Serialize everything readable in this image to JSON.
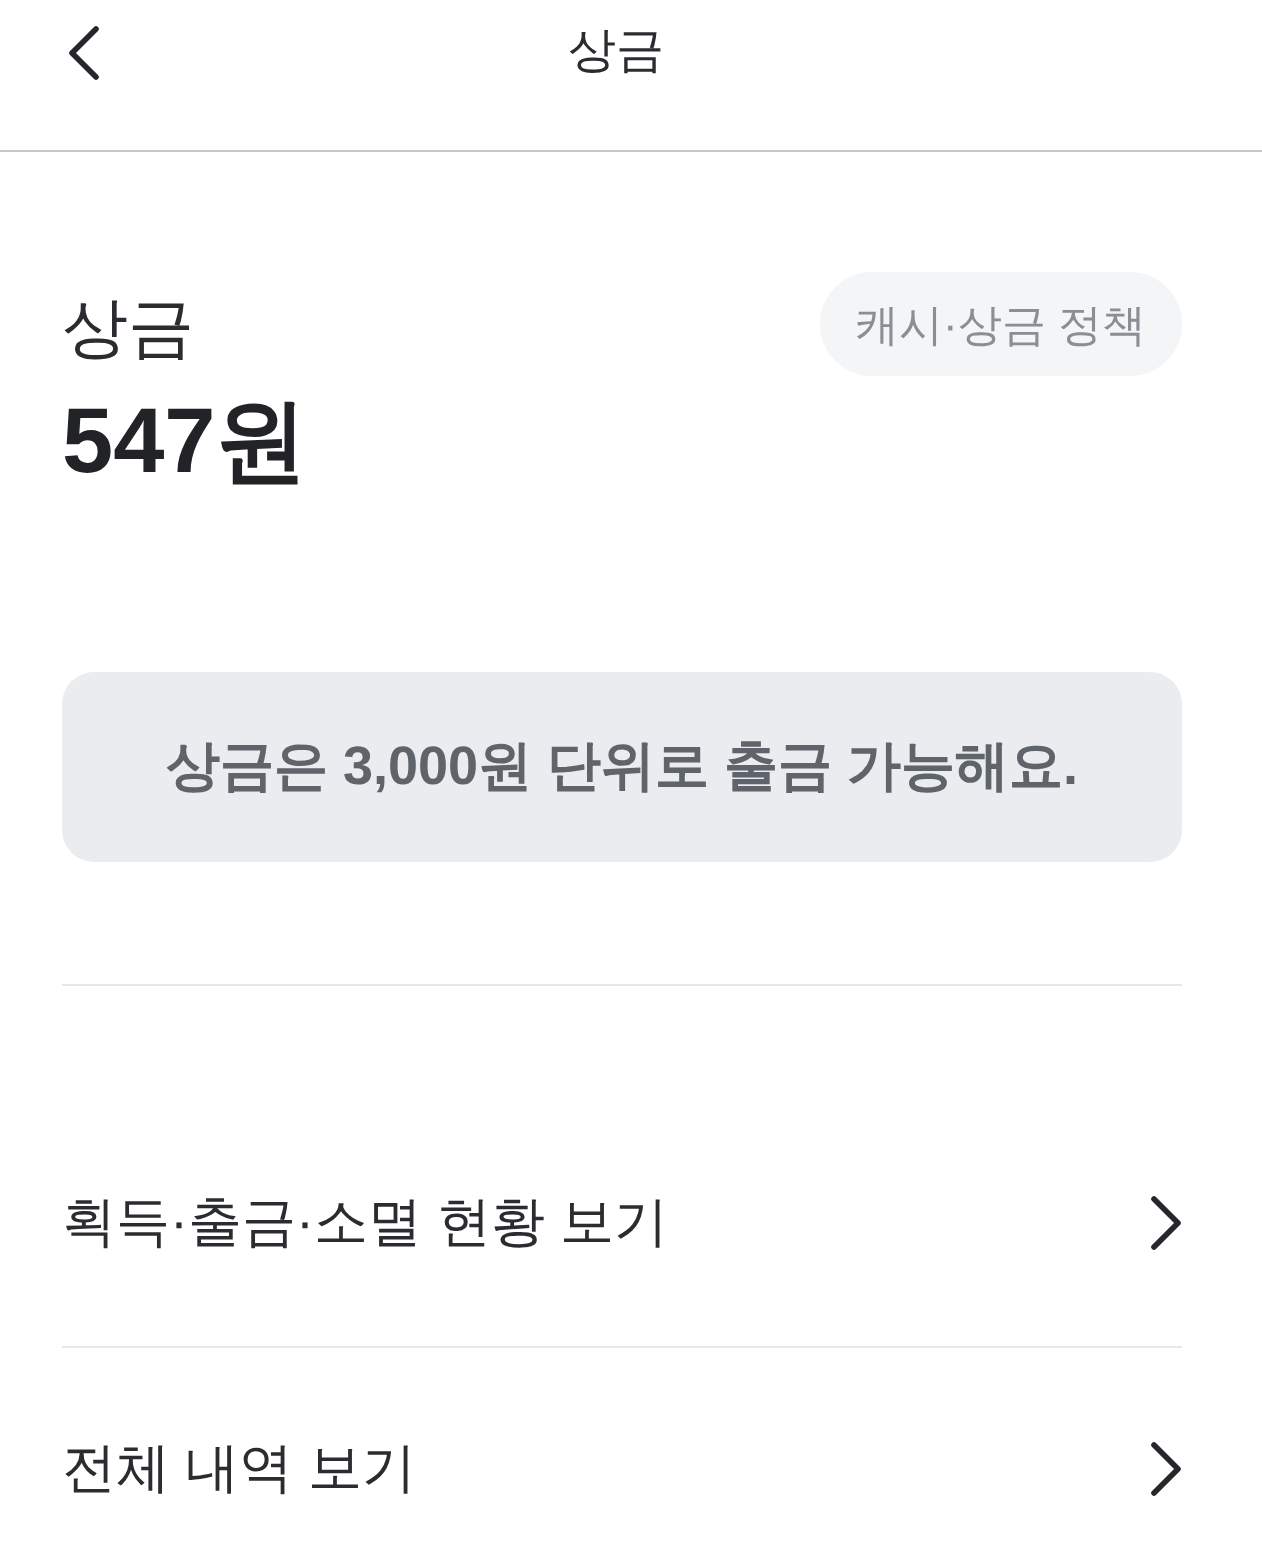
{
  "header": {
    "title": "상금"
  },
  "prize": {
    "label": "상금",
    "amount": "547원",
    "policy_button": "캐시·상금 정책"
  },
  "notice": "상금은 3,000원 단위로 출금 가능해요.",
  "menu": [
    {
      "label": "획득·출금·소멸 현황 보기"
    },
    {
      "label": "전체 내역 보기"
    }
  ]
}
